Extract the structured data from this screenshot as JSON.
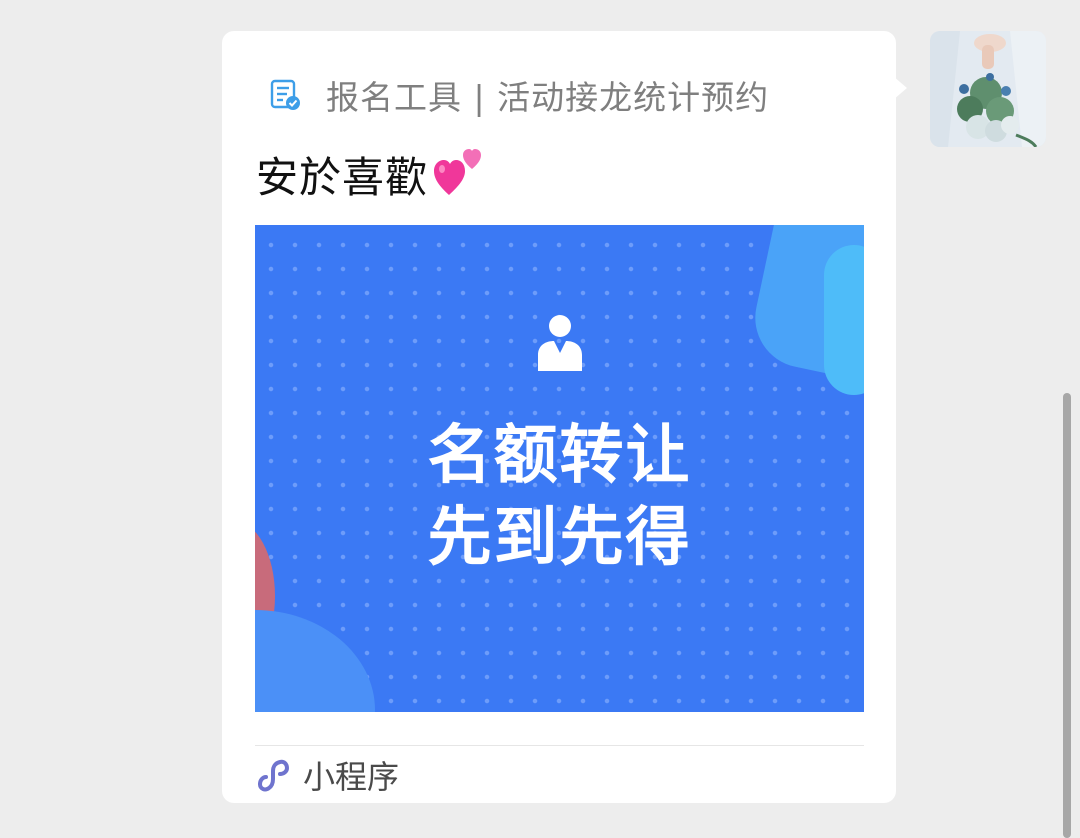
{
  "message": {
    "app_name": "报名工具 | 活动接龙统计预约",
    "title": "安於喜歡",
    "cover_line1": "名额转让",
    "cover_line2": "先到先得",
    "source_label": "小程序"
  },
  "icons": {
    "app_icon": "document-check-icon",
    "emoji": "two-hearts-emoji",
    "cover_icon": "person-icon",
    "source_icon": "mini-program-icon"
  },
  "colors": {
    "cover_blue": "#3b79f4",
    "card_bg": "#ffffff",
    "page_bg": "#ededed"
  }
}
